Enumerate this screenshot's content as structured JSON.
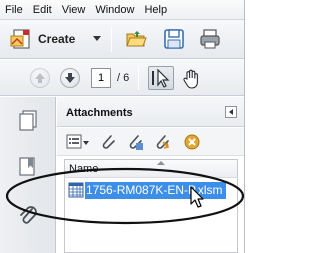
{
  "menubar": {
    "items": [
      "File",
      "Edit",
      "View",
      "Window",
      "Help"
    ]
  },
  "toolbar": {
    "create_label": "Create",
    "icons": [
      "create-pdf-icon",
      "open-folder-icon",
      "save-icon",
      "print-icon"
    ]
  },
  "navigation": {
    "current_page": "1",
    "total_pages": "/ 6",
    "icons": [
      "previous-page-icon",
      "next-page-icon",
      "select-tool-icon",
      "hand-tool-icon"
    ]
  },
  "navigation_pane": {
    "icons": [
      "page-thumbnails-icon",
      "bookmarks-icon",
      "attachments-icon"
    ]
  },
  "attachments_panel": {
    "title": "Attachments",
    "tool_icons": [
      "options-menu-icon",
      "open-attachment-icon",
      "save-attachment-icon",
      "add-attachment-icon",
      "delete-attachment-icon"
    ],
    "column_name": "Name",
    "files": [
      {
        "name": "1756-RM087K-EN-P.xlsm",
        "icon": "excel-file-icon",
        "selected": true
      }
    ]
  },
  "colors": {
    "selection": "#3d8ee8",
    "annotation_ellipse": "#111111"
  }
}
